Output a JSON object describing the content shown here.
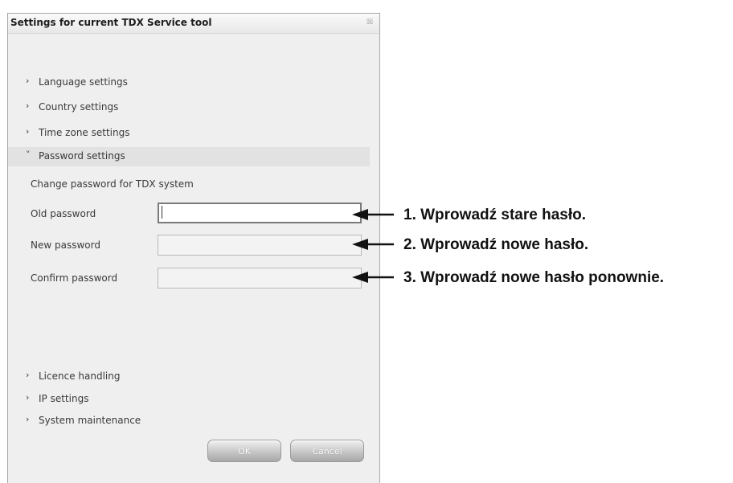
{
  "dialog": {
    "title": "Settings for current TDX Service tool",
    "close_glyph": "☒"
  },
  "sections": {
    "language": {
      "label": "Language settings",
      "icon": "chevron-right-icon",
      "chevron": "›"
    },
    "country": {
      "label": "Country settings",
      "icon": "chevron-right-icon",
      "chevron": "›"
    },
    "timezone": {
      "label": "Time zone settings",
      "icon": "chevron-right-icon",
      "chevron": "›"
    },
    "password": {
      "label": "Password settings",
      "icon": "chevron-down-icon",
      "chevron": "˅"
    },
    "licence": {
      "label": "Licence handling",
      "icon": "chevron-right-icon",
      "chevron": "›"
    },
    "ip": {
      "label": "IP settings",
      "icon": "chevron-right-icon",
      "chevron": "›"
    },
    "maintenance": {
      "label": "System maintenance",
      "icon": "chevron-right-icon",
      "chevron": "›"
    }
  },
  "password_panel": {
    "heading": "Change password for TDX system",
    "old_label": "Old password",
    "new_label": "New password",
    "confirm_label": "Confirm password",
    "old_value": "",
    "new_value": "",
    "confirm_value": ""
  },
  "buttons": {
    "ok": "OK",
    "cancel": "Cancel"
  },
  "annotations": [
    "1. Wprowadź stare hasło.",
    "2. Wprowadź nowe hasło.",
    "3. Wprowadź nowe hasło ponownie."
  ],
  "colors": {
    "dialog_bg": "#efefef",
    "open_section_bg": "#e2e2e2",
    "annotation_text": "#111111"
  }
}
